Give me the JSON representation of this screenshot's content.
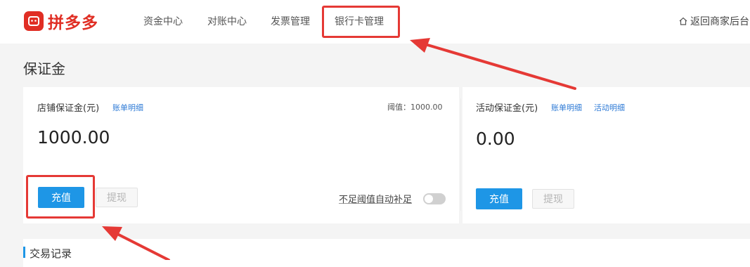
{
  "brand": {
    "name": "拼多多"
  },
  "nav": {
    "items": [
      "资金中心",
      "对账中心",
      "发票管理",
      "银行卡管理"
    ],
    "back": "返回商家后台"
  },
  "page": {
    "title": "保证金"
  },
  "store_deposit": {
    "label": "店铺保证金(元)",
    "link": "账单明细",
    "threshold": "阈值：1000.00",
    "amount": "1000.00",
    "recharge": "充值",
    "withdraw": "提现",
    "auto_topup": "不足阈值自动补足"
  },
  "activity_deposit": {
    "label": "活动保证金(元)",
    "link_bill": "账单明细",
    "link_activity": "活动明细",
    "amount": "0.00",
    "recharge": "充值",
    "withdraw": "提现"
  },
  "transactions": {
    "title": "交易记录"
  },
  "colors": {
    "brand": "#e02e24",
    "accent": "#1e96e6",
    "annotation": "#e53935",
    "link": "#2f7bd6"
  }
}
